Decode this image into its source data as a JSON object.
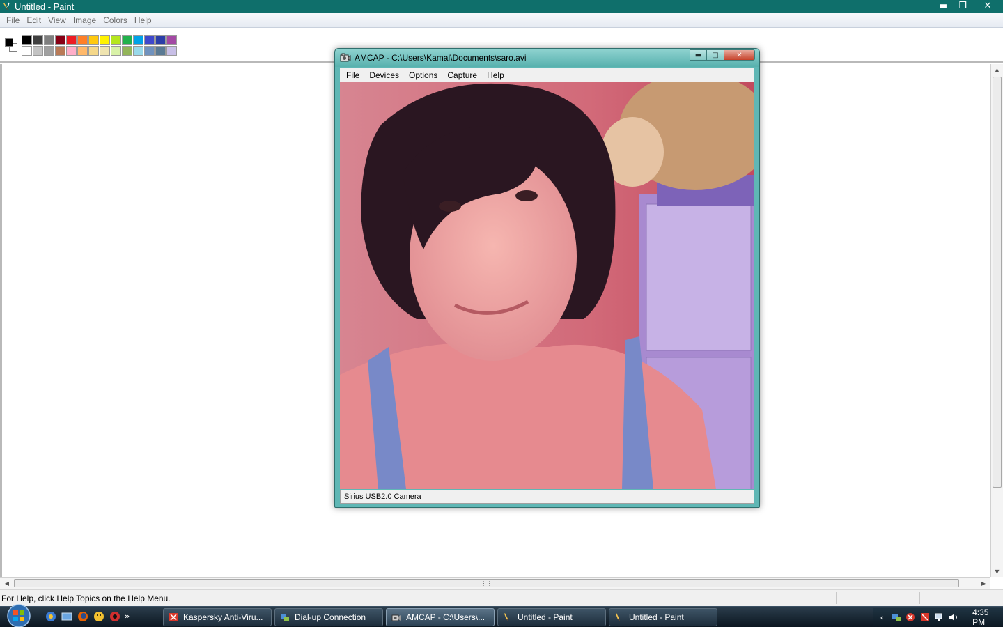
{
  "paint": {
    "title": "Untitled - Paint",
    "menu": [
      "File",
      "Edit",
      "View",
      "Image",
      "Colors",
      "Help"
    ],
    "palette_top": [
      "#000000",
      "#3f3f3f",
      "#7f7f7f",
      "#880015",
      "#ed1c24",
      "#ff7f27",
      "#ffc90e",
      "#fff200",
      "#b5e61d",
      "#22b14c",
      "#00a2e8",
      "#3f48cc",
      "#2b3ea8",
      "#a349a4"
    ],
    "palette_bottom": [
      "#ffffff",
      "#c3c3c3",
      "#a0a0a0",
      "#b97a57",
      "#ffaec9",
      "#ffb96b",
      "#f5d88a",
      "#efe4b0",
      "#d9f2a8",
      "#93b55a",
      "#99d9ea",
      "#7092be",
      "#5a7a94",
      "#c8bfe7"
    ],
    "status_text": "For Help, click Help Topics on the Help Menu."
  },
  "amcap": {
    "title": "AMCAP - C:\\Users\\Kamal\\Documents\\saro.avi",
    "menu": [
      "File",
      "Devices",
      "Options",
      "Capture",
      "Help"
    ],
    "status_text": "Sirius USB2.0 Camera"
  },
  "taskbar": {
    "buttons": [
      {
        "label": "Kaspersky Anti-Viru...",
        "icon": "kaspersky-icon",
        "color": "#d8372b"
      },
      {
        "label": "Dial-up Connection",
        "icon": "network-connection-icon",
        "color": "#4c8fd6"
      },
      {
        "label": "AMCAP - C:\\Users\\...",
        "icon": "camera-icon",
        "color": "#cfcfcf"
      },
      {
        "label": "Untitled - Paint",
        "icon": "paint-icon",
        "color": "#f2c14e"
      },
      {
        "label": "Untitled - Paint",
        "icon": "paint-icon",
        "color": "#f2c14e"
      }
    ],
    "clock": "4:35 PM"
  }
}
